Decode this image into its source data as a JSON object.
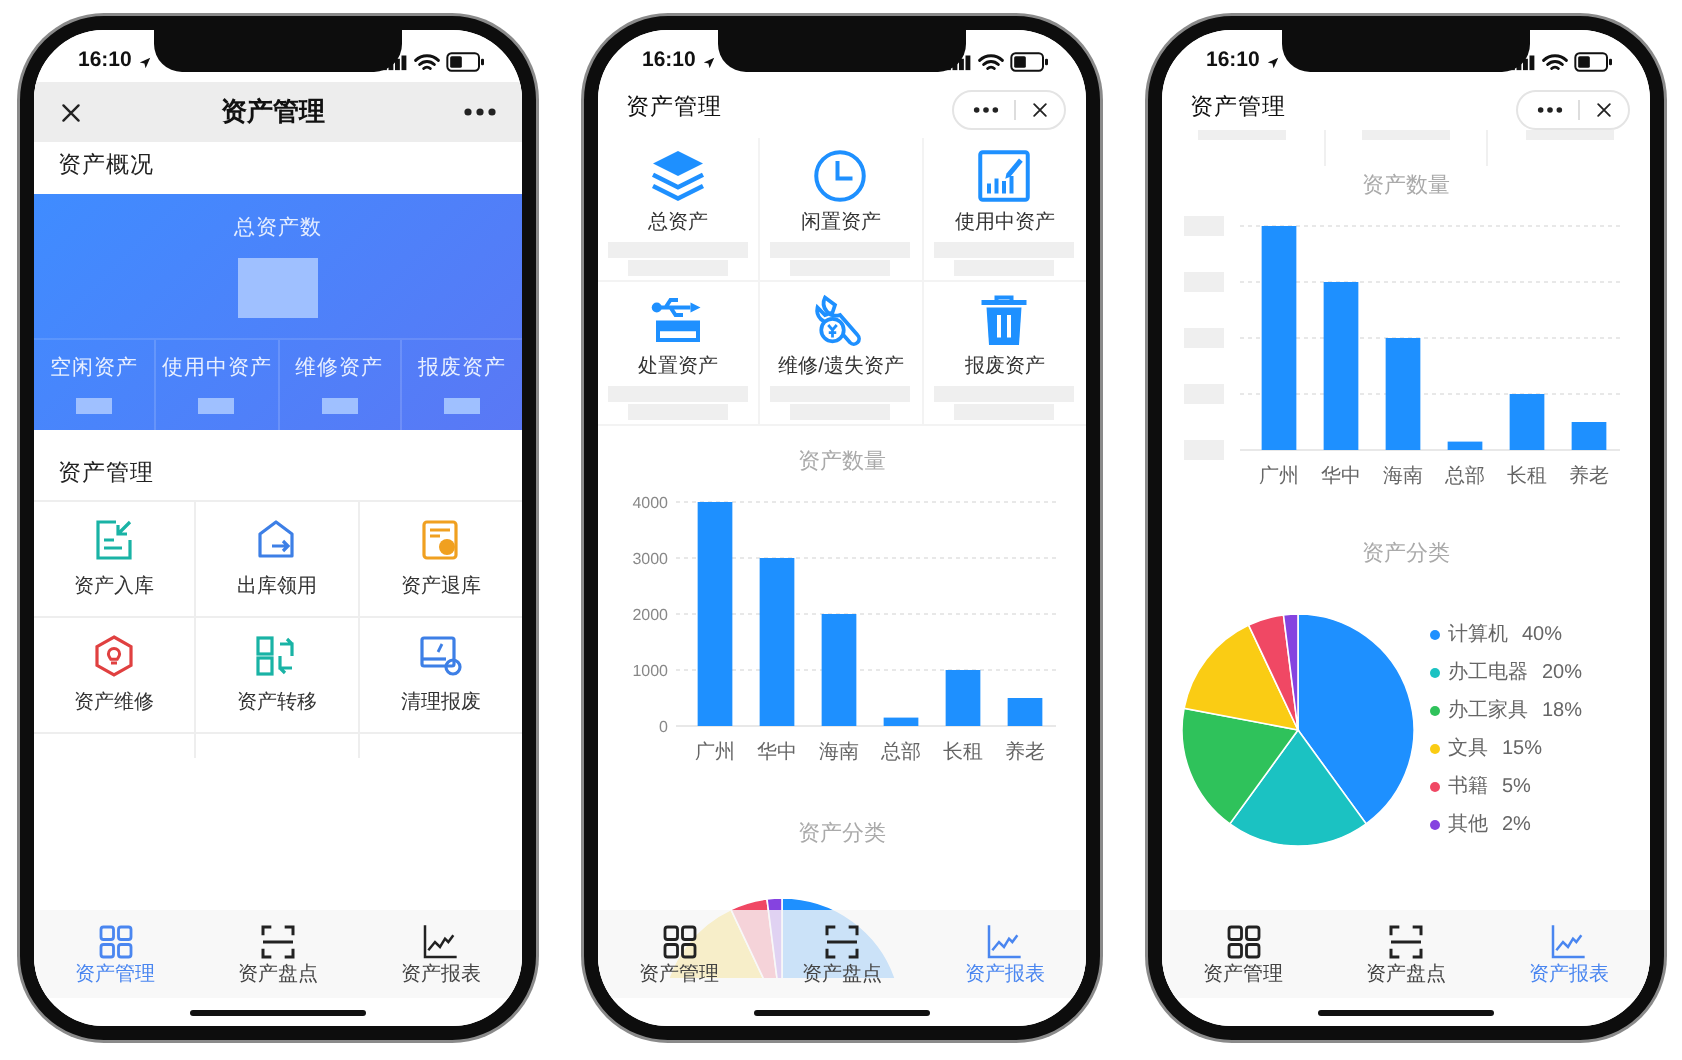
{
  "phones": [
    {
      "kind": "manage",
      "status_time": "16:10",
      "nav_title": "资产管理",
      "overview": {
        "heading": "资产概况",
        "total_label": "总资产数",
        "stats": [
          "空闲资产",
          "使用中资产",
          "维修资产",
          "报废资产"
        ]
      },
      "management": {
        "heading": "资产管理",
        "items": [
          {
            "label": "资产入库",
            "kind": "inbound"
          },
          {
            "label": "出库领用",
            "kind": "outbound"
          },
          {
            "label": "资产退库",
            "kind": "return"
          },
          {
            "label": "资产维修",
            "kind": "repair"
          },
          {
            "label": "资产转移",
            "kind": "transfer"
          },
          {
            "label": "清理报废",
            "kind": "scrap"
          }
        ]
      },
      "tabbar": [
        {
          "label": "资产管理",
          "kind": "grid",
          "selected": true
        },
        {
          "label": "资产盘点",
          "kind": "scan",
          "selected": false
        },
        {
          "label": "资产报表",
          "kind": "chart",
          "selected": false
        }
      ]
    },
    {
      "kind": "dashboard",
      "status_time": "16:10",
      "page_title": "资产管理",
      "tiles": [
        {
          "label": "总资产",
          "kind": "layers"
        },
        {
          "label": "闲置资产",
          "kind": "clock"
        },
        {
          "label": "使用中资产",
          "kind": "chart"
        },
        {
          "label": "处置资产",
          "kind": "usb"
        },
        {
          "label": "维修/遗失资产",
          "kind": "wrench"
        },
        {
          "label": "报废资产",
          "kind": "trash"
        }
      ],
      "bar_chart": {
        "chart_data": {
          "type": "bar",
          "title": "资产数量",
          "categories": [
            "广州",
            "华中",
            "海南",
            "总部",
            "长租",
            "养老"
          ],
          "values": [
            4000,
            3000,
            2000,
            150,
            1000,
            500
          ],
          "ylim": [
            0,
            4000
          ],
          "yticks": [
            0,
            1000,
            2000,
            3000,
            4000
          ],
          "grid": true
        }
      },
      "pie_title": "资产分类",
      "tabbar": [
        {
          "label": "资产管理",
          "kind": "grid",
          "selected": false
        },
        {
          "label": "资产盘点",
          "kind": "scan",
          "selected": false
        },
        {
          "label": "资产报表",
          "kind": "chart",
          "selected": true
        }
      ]
    },
    {
      "kind": "report",
      "status_time": "16:10",
      "page_title": "资产管理",
      "bar_chart": {
        "title": "资产数量",
        "categories": [
          "广州",
          "华中",
          "海南",
          "总部",
          "长租",
          "养老"
        ]
      },
      "pie_chart": {
        "chart_data": {
          "type": "pie",
          "title": "资产分类",
          "categories": [
            "计算机",
            "办工电器",
            "办工家具",
            "文具",
            "书籍",
            "其他"
          ],
          "values": [
            40,
            20,
            18,
            15,
            5,
            2
          ],
          "value_labels": [
            "40%",
            "20%",
            "18%",
            "15%",
            "5%",
            "2%"
          ],
          "colors": [
            "#1e90ff",
            "#1bc2c2",
            "#2fc25b",
            "#facc14",
            "#f04864",
            "#8543e0"
          ],
          "legend": "right"
        }
      },
      "tabbar": [
        {
          "label": "资产管理",
          "kind": "grid",
          "selected": false
        },
        {
          "label": "资产盘点",
          "kind": "scan",
          "selected": false
        },
        {
          "label": "资产报表",
          "kind": "chart",
          "selected": true
        }
      ]
    }
  ]
}
